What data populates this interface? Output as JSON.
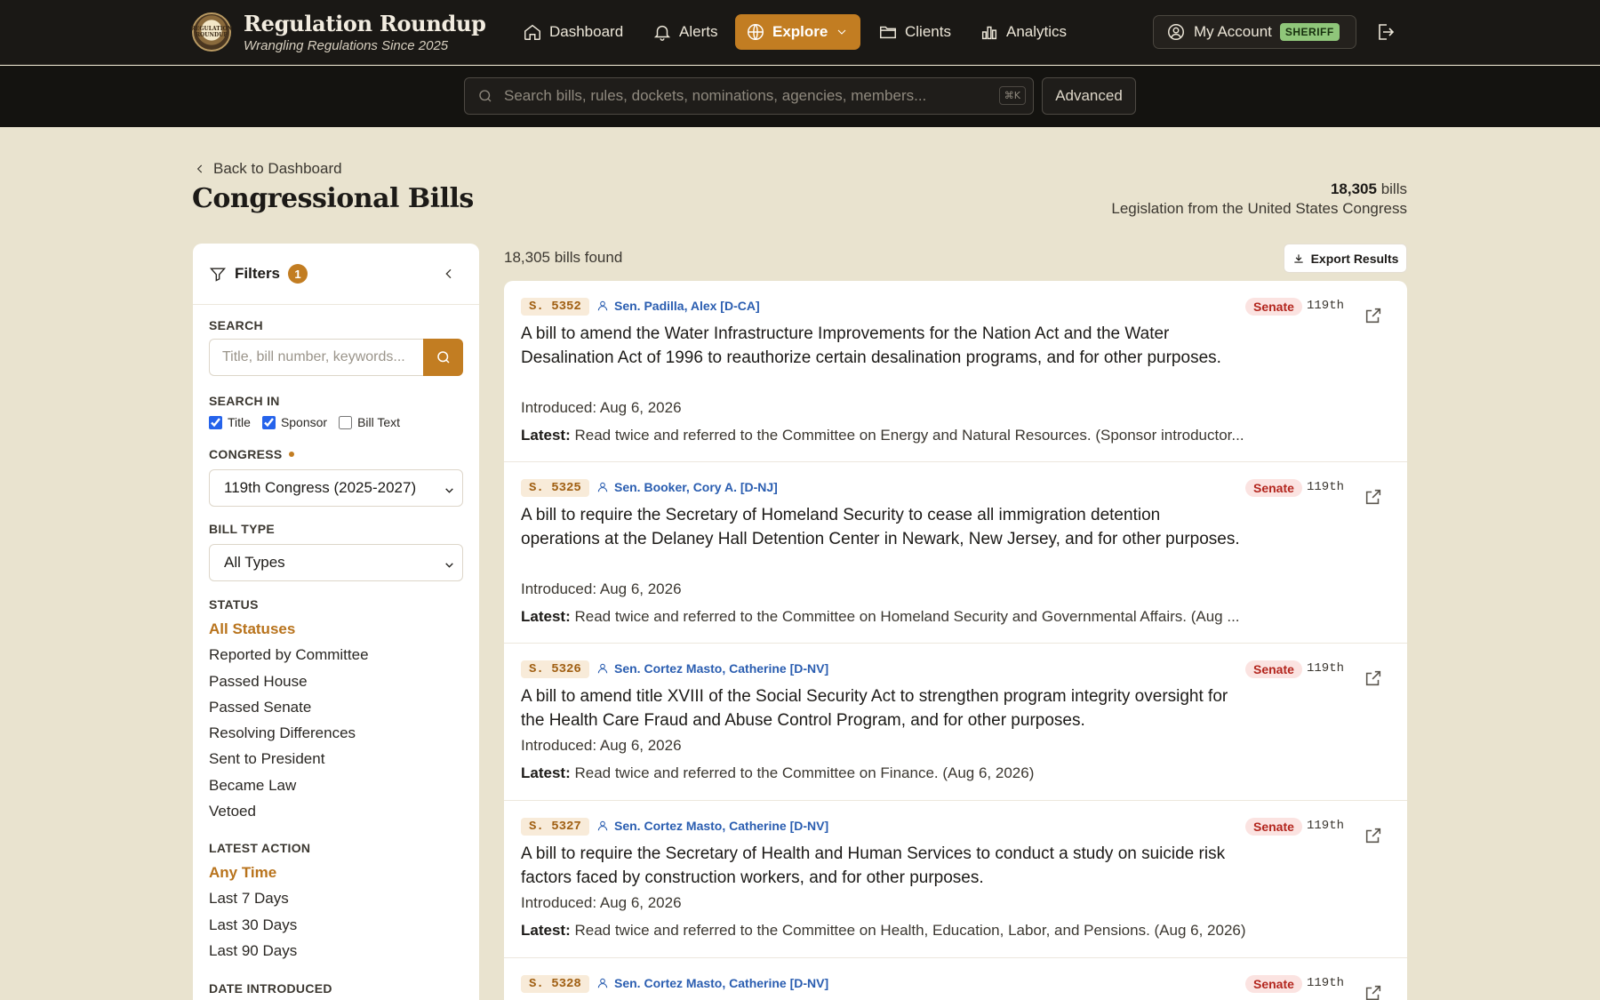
{
  "app": {
    "name": "Regulation Roundup",
    "tagline": "Wrangling Regulations Since 2025",
    "logo_text": "REGULATION ROUNDUP"
  },
  "nav": {
    "dashboard": "Dashboard",
    "alerts": "Alerts",
    "explore": "Explore",
    "clients": "Clients",
    "analytics": "Analytics",
    "account": "My Account",
    "role_badge": "SHERIFF"
  },
  "search": {
    "placeholder": "Search bills, rules, dockets, nominations, agencies, members...",
    "shortcut": "⌘K",
    "advanced": "Advanced"
  },
  "page": {
    "back": "Back to Dashboard",
    "title": "Congressional Bills",
    "count": "18,305",
    "count_unit": "bills",
    "subtitle": "Legislation from the United States Congress"
  },
  "filters": {
    "title": "Filters",
    "active_count": "1",
    "search_label": "SEARCH",
    "search_placeholder": "Title, bill number, keywords...",
    "search_in_label": "SEARCH IN",
    "search_in": [
      {
        "label": "Title",
        "checked": true
      },
      {
        "label": "Sponsor",
        "checked": true
      },
      {
        "label": "Bill Text",
        "checked": false
      }
    ],
    "congress_label": "CONGRESS",
    "congress_value": "119th Congress (2025-2027)",
    "bill_type_label": "BILL TYPE",
    "bill_type_value": "All Types",
    "status_label": "STATUS",
    "statuses": [
      "All Statuses",
      "Reported by Committee",
      "Passed House",
      "Passed Senate",
      "Resolving Differences",
      "Sent to President",
      "Became Law",
      "Vetoed"
    ],
    "latest_action_label": "LATEST ACTION",
    "latest_actions": [
      "Any Time",
      "Last 7 Days",
      "Last 30 Days",
      "Last 90 Days"
    ],
    "date_introduced_label": "DATE INTRODUCED"
  },
  "results": {
    "found": "18,305 bills found",
    "export": "Export Results",
    "intro_prefix": "Introduced:",
    "latest_prefix": "Latest:",
    "bills": [
      {
        "number": "S. 5352",
        "sponsor": "Sen. Padilla, Alex [D-CA]",
        "chamber": "Senate",
        "congress": "119th",
        "title": "A bill to amend the Water Infrastructure Improvements for the Nation Act and the Water Desalination Act of 1996 to reauthorize certain desalination programs, and for other purposes.",
        "introduced": "Aug 6, 2026",
        "latest": "Read twice and referred to the Committee on Energy and Natural Resources. (Sponsor introductor..."
      },
      {
        "number": "S. 5325",
        "sponsor": "Sen. Booker, Cory A. [D-NJ]",
        "chamber": "Senate",
        "congress": "119th",
        "title": "A bill to require the Secretary of Homeland Security to cease all immigration detention operations at the Delaney Hall Detention Center in Newark, New Jersey, and for other purposes.",
        "introduced": "Aug 6, 2026",
        "latest": "Read twice and referred to the Committee on Homeland Security and Governmental Affairs. (Aug ..."
      },
      {
        "number": "S. 5326",
        "sponsor": "Sen. Cortez Masto, Catherine [D-NV]",
        "chamber": "Senate",
        "congress": "119th",
        "title": "A bill to amend title XVIII of the Social Security Act to strengthen program integrity oversight for the Health Care Fraud and Abuse Control Program, and for other purposes.",
        "introduced": "Aug 6, 2026",
        "latest": "Read twice and referred to the Committee on Finance. (Aug 6, 2026)"
      },
      {
        "number": "S. 5327",
        "sponsor": "Sen. Cortez Masto, Catherine [D-NV]",
        "chamber": "Senate",
        "congress": "119th",
        "title": "A bill to require the Secretary of Health and Human Services to conduct a study on suicide risk factors faced by construction workers, and for other purposes.",
        "introduced": "Aug 6, 2026",
        "latest": "Read twice and referred to the Committee on Health, Education, Labor, and Pensions. (Aug 6, 2026)"
      },
      {
        "number": "S. 5328",
        "sponsor": "Sen. Cortez Masto, Catherine [D-NV]",
        "chamber": "Senate",
        "congress": "119th",
        "title": "",
        "introduced": "",
        "latest": ""
      }
    ]
  },
  "colors": {
    "accent": "#c27d22",
    "nav_bg": "#1a1815",
    "page_bg": "#e9e3cf",
    "sponsor_link": "#2a5db0",
    "chamber_badge": "#b3261e"
  }
}
